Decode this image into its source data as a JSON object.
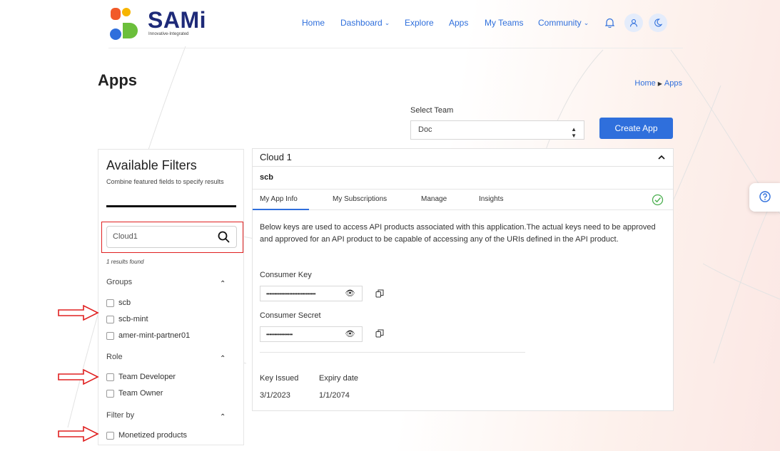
{
  "brand": {
    "name": "SAMi",
    "tagline": "Innovative-Integrated"
  },
  "nav": {
    "items": [
      {
        "label": "Home",
        "dropdown": false
      },
      {
        "label": "Dashboard",
        "dropdown": true
      },
      {
        "label": "Explore",
        "dropdown": false
      },
      {
        "label": "Apps",
        "dropdown": false
      },
      {
        "label": "My Teams",
        "dropdown": false
      },
      {
        "label": "Community",
        "dropdown": true
      }
    ],
    "icons": [
      "bell-icon",
      "user-icon",
      "moon-icon"
    ]
  },
  "page": {
    "title": "Apps",
    "breadcrumb": [
      "Home",
      "Apps"
    ]
  },
  "team_select": {
    "label": "Select Team",
    "value": "Doc"
  },
  "create_button": "Create App",
  "filters": {
    "title": "Available Filters",
    "subtitle": "Combine featured fields to specify results",
    "search_value": "Cloud1",
    "results_text": "1 results found",
    "groups": [
      {
        "title": "Groups",
        "options": [
          "scb",
          "scb-mint",
          "amer-mint-partner01"
        ]
      },
      {
        "title": "Role",
        "options": [
          "Team Developer",
          "Team Owner"
        ]
      },
      {
        "title": "Filter by",
        "options": [
          "Monetized products"
        ]
      }
    ]
  },
  "app": {
    "name": "Cloud 1",
    "subtitle": "scb",
    "tabs": [
      "My App Info",
      "My Subscriptions",
      "Manage",
      "Insights"
    ],
    "active_tab": "My App Info",
    "description": "Below keys are used to access API products associated with this application.The actual keys need to be approved and approved for an API product to be capable of accessing any of the URIs defined in the API product.",
    "consumer_key_label": "Consumer Key",
    "consumer_key_value": "••••••••••••••••••••••••••••••",
    "consumer_secret_label": "Consumer Secret",
    "consumer_secret_value": "••••••••••••••••",
    "key_issued_label": "Key Issued",
    "key_issued_value": "3/1/2023",
    "expiry_label": "Expiry date",
    "expiry_value": "1/1/2074"
  },
  "colors": {
    "accent": "#2f6fdc",
    "annotation": "#e02020",
    "brand_navy": "#1e2a78"
  }
}
